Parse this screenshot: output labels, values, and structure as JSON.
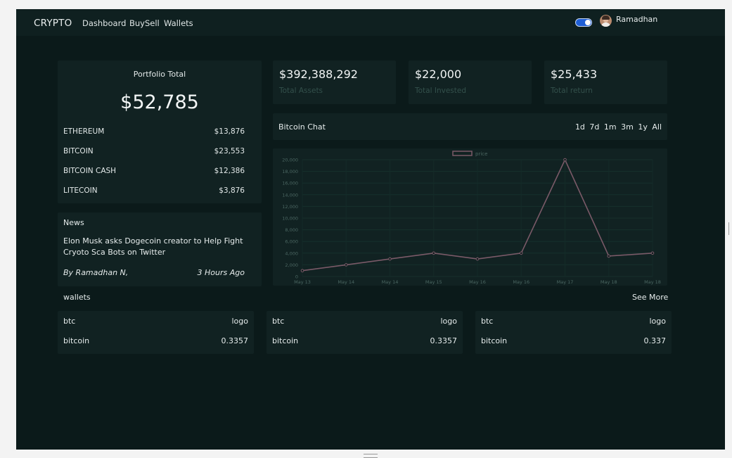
{
  "nav": {
    "brand": "CRYPTO",
    "links": [
      "Dashboard",
      "BuySell",
      "Wallets"
    ],
    "username": "Ramadhan"
  },
  "portfolio": {
    "title": "Portfolio Total",
    "total": "$52,785",
    "items": [
      {
        "name": "ETHEREUM",
        "value": "$13,876"
      },
      {
        "name": "BITCOIN",
        "value": "$23,553"
      },
      {
        "name": "BITCOIN CASH",
        "value": "$12,386"
      },
      {
        "name": "LITECOIN",
        "value": "$3,876"
      }
    ]
  },
  "stats": [
    {
      "value": "$392,388,292",
      "label": "Total Assets"
    },
    {
      "value": "$22,000",
      "label": "Total Invested"
    },
    {
      "value": "$25,433",
      "label": "Total return"
    }
  ],
  "chart_header": {
    "title": "Bitcoin Chat",
    "ranges": [
      "1d",
      "7d",
      "1m",
      "3m",
      "1y",
      "All"
    ]
  },
  "news": {
    "title": "News",
    "headline": "Elon Musk asks Dogecoin creator to Help Fight Cryoto Sca Bots on Twitter",
    "author": "By Ramadhan N,",
    "time": "3 Hours Ago"
  },
  "wallets": {
    "title": "wallets",
    "see_more": "See More",
    "cards": [
      {
        "symbol": "btc",
        "logo": "logo",
        "name": "bitcoin",
        "amount": "0.3357"
      },
      {
        "symbol": "btc",
        "logo": "logo",
        "name": "bitcoin",
        "amount": "0.3357"
      },
      {
        "symbol": "btc",
        "logo": "logo",
        "name": "bitcoin",
        "amount": "0.337"
      }
    ]
  },
  "colors": {
    "background": "#0b1a1a",
    "card": "#112222",
    "line": "#7a5a68",
    "toggle": "#1f5fd6"
  },
  "chart_data": {
    "type": "line",
    "categories": [
      "May 13",
      "May 14",
      "May 14",
      "May 15",
      "May 16",
      "May 16",
      "May 17",
      "May 18",
      "May 18"
    ],
    "series": [
      {
        "name": "price",
        "values": [
          1000,
          2000,
          3000,
          4000,
          3000,
          4000,
          20000,
          3500,
          4000
        ]
      }
    ],
    "yticks": [
      "0",
      "2,000",
      "4,000",
      "6,000",
      "8,000",
      "10,000",
      "12,000",
      "14,000",
      "16,000",
      "18,000",
      "20,000"
    ],
    "ylim": [
      0,
      20000
    ],
    "legend": "top",
    "grid": true
  }
}
